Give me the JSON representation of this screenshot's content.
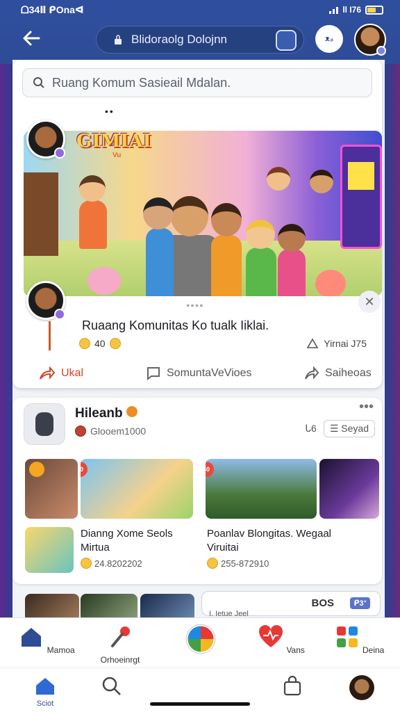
{
  "status": {
    "time": "ᗝ34Ⅱ ᑭOnaᐊ",
    "battery_text": "ll I76",
    "icons": [
      "signal-icon",
      "battery-icon"
    ]
  },
  "header": {
    "title": "Blidoraolg Dolojnn",
    "menu_label": "ᴥ₃",
    "icons": [
      "back-arrow-icon",
      "lock-icon",
      "chat-icon",
      "profile-avatar"
    ]
  },
  "search": {
    "placeholder": "Ruang Komum Sasieail Mdalan."
  },
  "featured": {
    "logo_text": "GIMIAI",
    "logo_sub": "Vu",
    "title": "Ruaang Komunitas Ko tualk Iiklai.",
    "reactions": "40",
    "views": "Yirnai J75",
    "actions": {
      "share": "Ukal",
      "comment": "SomuntaVeVioes",
      "send": "Saiheoas"
    }
  },
  "group": {
    "name": "Hileanb",
    "subtitle": "Glooem1000",
    "sort_count": "ᒐ6",
    "sort_label": "Seyad"
  },
  "tiles": [
    {
      "badge": "60",
      "title": "Dianng Xome Seols",
      "title2": "Mirtua",
      "meta": "24.8202202"
    },
    {
      "badge": "60",
      "title": "Poanlav Blongitas.  Wegaal",
      "title2": "Viruitai",
      "meta": "255-872910"
    }
  ],
  "row3": {
    "chip_label": "BOS",
    "chip_badge": "ᑭ3ᐩ",
    "caption": "I. Ietue Jeel"
  },
  "nav": [
    {
      "label": "Mamoa",
      "icon": "home-icon"
    },
    {
      "label": "Orhoeinrgt",
      "icon": "microphone-icon"
    },
    {
      "label": "",
      "icon": "colorwheel-icon"
    },
    {
      "label": "Vans",
      "icon": "heart-icon"
    },
    {
      "label": "Deina",
      "icon": "puzzle-icon"
    }
  ],
  "tabs": [
    {
      "label": "Sciot",
      "icon": "home-icon"
    },
    {
      "label": "",
      "icon": "search-icon"
    },
    {
      "label": "",
      "icon": "bag-icon"
    },
    {
      "label": "",
      "icon": "profile-avatar"
    }
  ],
  "colors": {
    "header": "#2e4b96",
    "accent": "#d2452b",
    "badge": "#e84a3b"
  }
}
